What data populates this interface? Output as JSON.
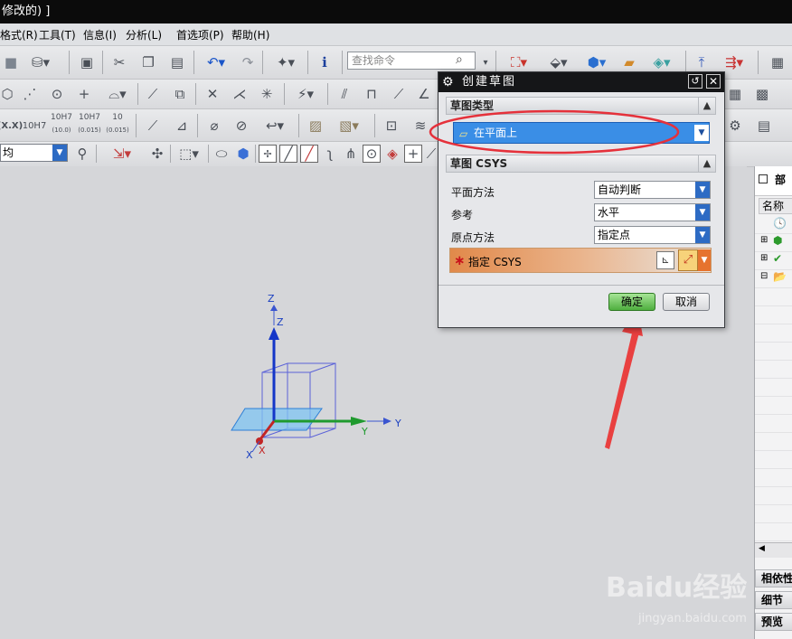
{
  "window": {
    "title": "修改的) ]"
  },
  "menu": [
    "格式(R)",
    "工具(T)",
    "信息(I)",
    "分析(L)",
    "首选项(P)",
    "帮助(H)"
  ],
  "search": {
    "placeholder": "查找命令"
  },
  "toolbar3": {
    "labels": [
      "(X.X)",
      "10H7",
      "10H7",
      "10H7",
      "10"
    ],
    "sublabels": [
      "",
      "",
      "(10.0)",
      "(0.015)",
      "(0.015)"
    ]
  },
  "view_select": {
    "value": "均"
  },
  "axes": {
    "z1": "Z",
    "z2": "Z",
    "y1": "Y",
    "y2": "Y",
    "x1": "X",
    "x2": "X"
  },
  "dialog": {
    "title": "创建草图",
    "sketch_type_section": "草图类型",
    "sketch_type_value": "在平面上",
    "csys_section": "草图 CSYS",
    "plane_method_label": "平面方法",
    "plane_method_value": "自动判断",
    "reference_label": "参考",
    "reference_value": "水平",
    "origin_method_label": "原点方法",
    "origin_method_value": "指定点",
    "specify_csys_label": "指定 CSYS",
    "ok": "确定",
    "cancel": "取消"
  },
  "right_panel": {
    "header": "部",
    "column": "名称",
    "tabs": [
      "相依性",
      "细节",
      "预览"
    ]
  },
  "watermark": {
    "brand": "Baidu经验",
    "url": "jingyan.baidu.com"
  },
  "colors": {
    "highlight_ellipse": "#e5313b",
    "arrow": "#e94040",
    "select_blue": "#3a8ee6",
    "ok_green": "#4fae3f"
  }
}
